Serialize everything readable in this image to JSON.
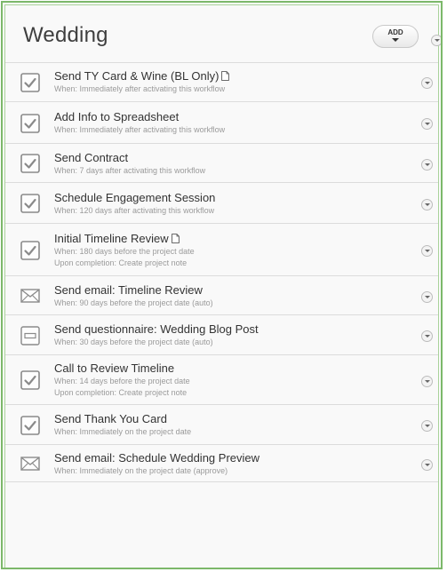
{
  "header": {
    "title": "Wedding",
    "add_label": "ADD"
  },
  "items": [
    {
      "icon": "checkbox-icon",
      "name": "Send TY Card & Wine (BL Only)",
      "has_doc": true,
      "when": "When: Immediately after activating this workflow",
      "extra": ""
    },
    {
      "icon": "checkbox-icon",
      "name": "Add Info to Spreadsheet",
      "has_doc": false,
      "when": "When: Immediately after activating this workflow",
      "extra": ""
    },
    {
      "icon": "checkbox-icon",
      "name": "Send Contract",
      "has_doc": false,
      "when": "When: 7 days after activating this workflow",
      "extra": ""
    },
    {
      "icon": "checkbox-icon",
      "name": "Schedule Engagement Session",
      "has_doc": false,
      "when": "When: 120 days after activating this workflow",
      "extra": ""
    },
    {
      "icon": "checkbox-icon",
      "name": "Initial Timeline Review",
      "has_doc": true,
      "when": "When: 180 days before the project date",
      "extra": "Upon completion: Create project note"
    },
    {
      "icon": "envelope-icon",
      "name": "Send email: Timeline Review",
      "has_doc": false,
      "when": "When: 90 days before the project date (auto)",
      "extra": ""
    },
    {
      "icon": "questionnaire-icon",
      "name": "Send questionnaire: Wedding Blog Post",
      "has_doc": false,
      "when": "When: 30 days before the project date (auto)",
      "extra": ""
    },
    {
      "icon": "checkbox-icon",
      "name": "Call to Review Timeline",
      "has_doc": false,
      "when": "When: 14 days before the project date",
      "extra": "Upon completion: Create project note"
    },
    {
      "icon": "checkbox-icon",
      "name": "Send Thank You Card",
      "has_doc": false,
      "when": "When: Immediately on the project date",
      "extra": ""
    },
    {
      "icon": "envelope-icon",
      "name": "Send email: Schedule Wedding Preview",
      "has_doc": false,
      "when": "When: Immediately on the project date (approve)",
      "extra": ""
    }
  ]
}
